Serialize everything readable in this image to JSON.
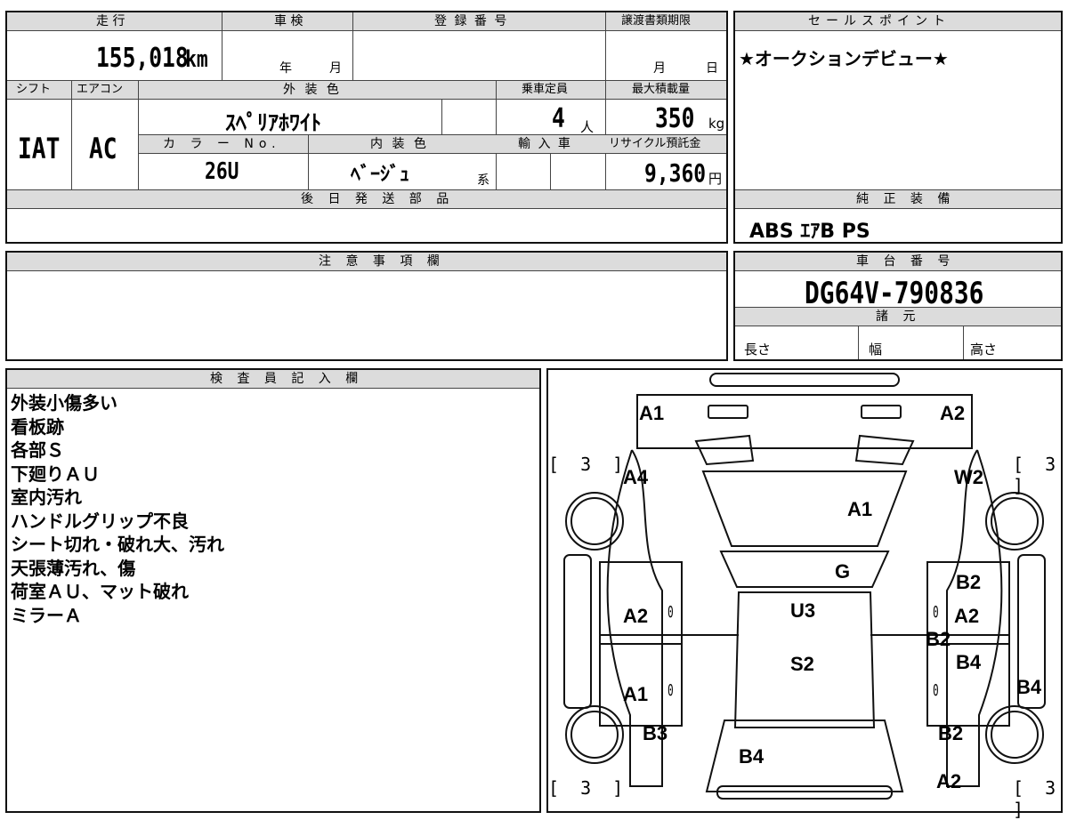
{
  "vehicle": {
    "mileage_label": "走 行",
    "mileage_value": "155,018",
    "mileage_unit": "km",
    "inspection_label": "車 検",
    "inspection_year_unit": "年",
    "inspection_month_unit": "月",
    "registration_label": "登 録 番 号",
    "registration_value": "",
    "transfer_doc_label": "譲渡書類期限",
    "transfer_month_unit": "月",
    "transfer_day_unit": "日",
    "shift_label": "シフト",
    "shift_value": "IAT",
    "ac_label": "エアコン",
    "ac_value": "AC",
    "exterior_color_label": "外 装 色",
    "exterior_color_value": "ｽﾍﾟﾘｱﾎﾜｲﾄ",
    "capacity_label": "乗車定員",
    "capacity_value": "4",
    "capacity_unit": "人",
    "max_load_label": "最大積載量",
    "max_load_value": "350",
    "max_load_unit": "kg",
    "color_no_label": "カ ラ ー No.",
    "color_no_value": "26U",
    "interior_color_label": "内 装 色",
    "interior_color_value": "ﾍﾞｰｼﾞｭ",
    "interior_suffix": "系",
    "import_label": "輸 入 車",
    "recycle_label": "リサイクル預託金",
    "recycle_value": "9,360",
    "recycle_unit": "円",
    "later_parts_label": "後 日 発 送 部 品"
  },
  "sales_point": {
    "label": "セールスポイント",
    "text": "★オークションデビュー★"
  },
  "equipment": {
    "label": "純 正 装 備",
    "value": "ABS ｴｱB PS"
  },
  "caution": {
    "label": "注 意 事 項 欄"
  },
  "chassis": {
    "label": "車 台 番 号",
    "value": "DG64V-790836",
    "specs_label": "諸 元",
    "length_label": "長さ",
    "width_label": "幅",
    "height_label": "高さ"
  },
  "inspector": {
    "label": "検 査 員 記 入 欄",
    "notes": [
      "外装小傷多い",
      "看板跡",
      "各部Ｓ",
      "下廻りＡＵ",
      "室内汚れ",
      "ハンドルグリップ不良",
      "シート切れ・破れ大、汚れ",
      "天張薄汚れ、傷",
      "荷室ＡＵ、マット破れ",
      "ミラーＡ"
    ]
  },
  "diagram": {
    "marks": {
      "front_left": "A1",
      "front_right": "A2",
      "left_front_fender": "A4",
      "right_front_fender": "W2",
      "hood": "A1",
      "windshield": "G",
      "roof_front": "U3",
      "roof_rear": "S2",
      "left_front_door": "A2",
      "left_rear_door": "A1",
      "right_upper": "B2",
      "right_front_door": "A2",
      "right_mid": "B2",
      "right_rear_door": "B4",
      "right_side_edge": "B4",
      "left_rear": "B3",
      "rear_gate": "B4",
      "right_rear": "B2",
      "rear_bumper_right": "A2"
    },
    "zero_mark": "0",
    "tire_bracket": "[ 3 ]"
  }
}
